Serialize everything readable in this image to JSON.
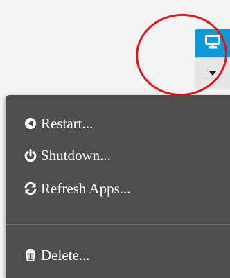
{
  "toolbar": {
    "monitor_icon": "monitor-icon",
    "caret_icon": "caret-down-icon",
    "accent_color": "#0e99d8",
    "highlight_color": "#e3151b"
  },
  "menu": {
    "items": [
      {
        "label": "Restart...",
        "icon": "restart-icon"
      },
      {
        "label": "Shutdown...",
        "icon": "power-icon"
      },
      {
        "label": "Refresh Apps...",
        "icon": "refresh-icon"
      },
      {
        "label": "Delete...",
        "icon": "trash-icon"
      }
    ],
    "background": "#4e4e4e"
  }
}
